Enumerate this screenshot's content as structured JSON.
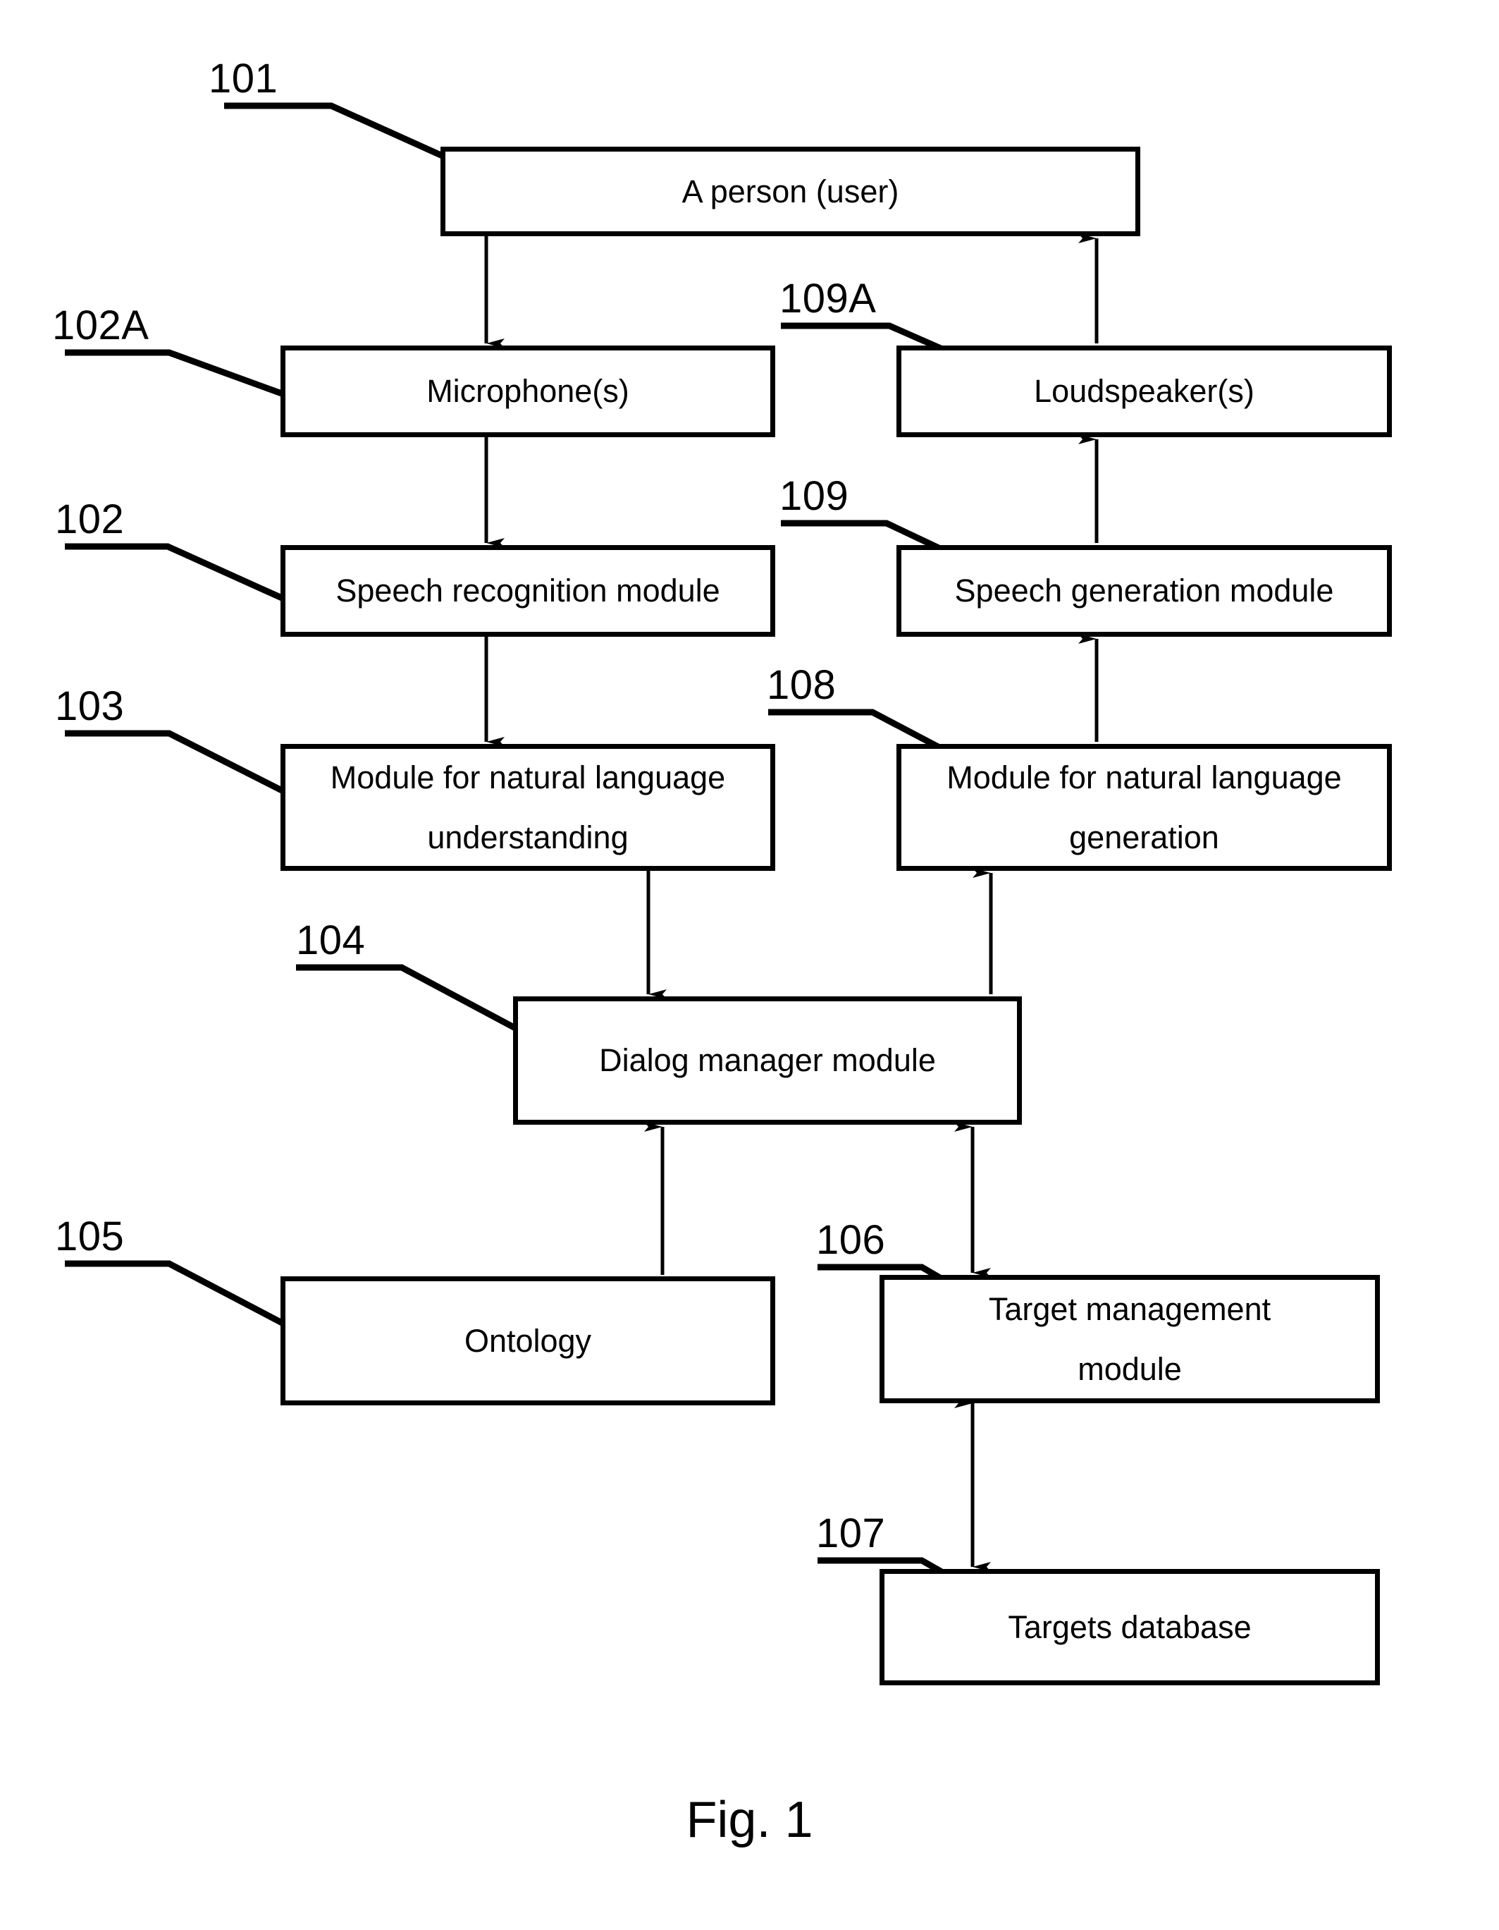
{
  "figure": {
    "caption": "Fig. 1",
    "nodes": [
      {
        "ref": "101",
        "label_line1": "A person (user)",
        "label_line2": ""
      },
      {
        "ref": "102A",
        "label_line1": "Microphone(s)",
        "label_line2": ""
      },
      {
        "ref": "109A",
        "label_line1": "Loudspeaker(s)",
        "label_line2": ""
      },
      {
        "ref": "102",
        "label_line1": "Speech recognition module",
        "label_line2": ""
      },
      {
        "ref": "109",
        "label_line1": "Speech generation module",
        "label_line2": ""
      },
      {
        "ref": "103",
        "label_line1": "Module for natural language",
        "label_line2": "understanding"
      },
      {
        "ref": "108",
        "label_line1": "Module for natural language",
        "label_line2": "generation"
      },
      {
        "ref": "104",
        "label_line1": "Dialog manager module",
        "label_line2": ""
      },
      {
        "ref": "105",
        "label_line1": "Ontology",
        "label_line2": ""
      },
      {
        "ref": "106",
        "label_line1": "Target management",
        "label_line2": "module"
      },
      {
        "ref": "107",
        "label_line1": "Targets database",
        "label_line2": ""
      }
    ],
    "colors": {
      "stroke": "#000000",
      "background": "#ffffff",
      "text": "#000000"
    }
  }
}
